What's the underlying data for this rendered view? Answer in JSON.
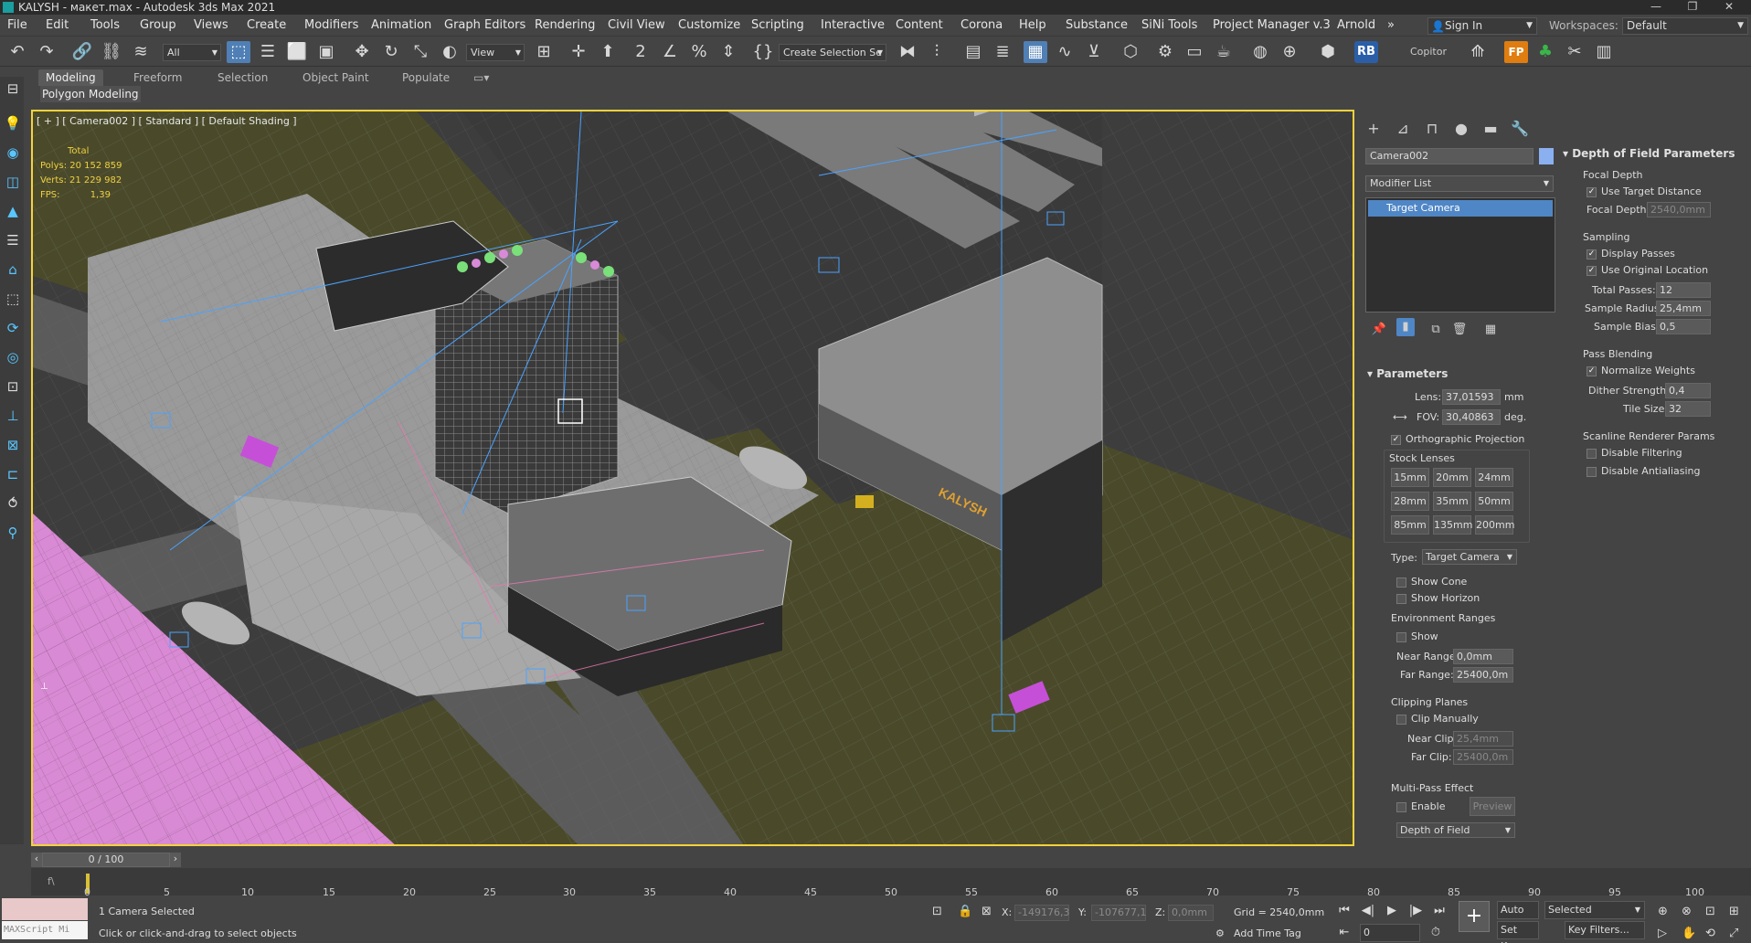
{
  "window": {
    "title": "KALYSH - макет.max - Autodesk 3ds Max 2021",
    "minimize": "—",
    "maximize": "❐",
    "close": "✕"
  },
  "menu": [
    "File",
    "Edit",
    "Tools",
    "Group",
    "Views",
    "Create",
    "Modifiers",
    "Animation",
    "Graph Editors",
    "Rendering",
    "Civil View",
    "Customize",
    "Scripting",
    "Interactive",
    "Content",
    "Corona",
    "Help",
    "Substance",
    "SiNi Tools",
    "Project Manager v.3",
    "Arnold"
  ],
  "menu_more": "»",
  "signin": "Sign In",
  "workspaces": {
    "label": "Workspaces:",
    "value": "Default"
  },
  "toolbar": {
    "filter": "All",
    "refcoord": "View",
    "selset": "Create Selection Se",
    "copitor": "Copitor",
    "rb": "RB",
    "fp": "FP",
    "two": "2",
    "pct": "%"
  },
  "ribbon": {
    "tabs": [
      "Modeling",
      "Freeform",
      "Selection",
      "Object Paint",
      "Populate"
    ],
    "sub": "Polygon Modeling"
  },
  "viewport": {
    "label": "[ + ] [ Camera002 ] [ Standard ] [ Default Shading ]",
    "stats": {
      "total_label": "Total",
      "polys_label": "Polys:",
      "polys": "20 152 859",
      "verts_label": "Verts:",
      "verts": "21 229 982",
      "fps_label": "FPS:",
      "fps": "1,39"
    },
    "sign": "KALYSH"
  },
  "cmd": {
    "object_name": "Camera002",
    "modifier_list": "Modifier List",
    "stack_item": "Target Camera",
    "params": {
      "header": "Parameters",
      "lens_label": "Lens:",
      "lens": "37,01593",
      "lens_unit": "mm",
      "fov_label": "FOV:",
      "fov": "30,40863",
      "fov_unit": "deg.",
      "ortho": "Orthographic Projection",
      "stock_label": "Stock Lenses",
      "stock": [
        "15mm",
        "20mm",
        "24mm",
        "28mm",
        "35mm",
        "50mm",
        "85mm",
        "135mm",
        "200mm"
      ],
      "type_label": "Type:",
      "type": "Target Camera",
      "show_cone": "Show Cone",
      "show_horizon": "Show Horizon",
      "env_label": "Environment Ranges",
      "env_show": "Show",
      "near_range_label": "Near Range:",
      "near_range": "0,0mm",
      "far_range_label": "Far Range:",
      "far_range": "25400,0m",
      "clip_label": "Clipping Planes",
      "clip_manually": "Clip Manually",
      "near_clip_label": "Near Clip:",
      "near_clip": "25,4mm",
      "far_clip_label": "Far Clip:",
      "far_clip": "25400,0m",
      "mpe_label": "Multi-Pass Effect",
      "enable": "Enable",
      "preview": "Preview",
      "effect": "Depth of Field"
    }
  },
  "dof": {
    "header": "Depth of Field Parameters",
    "focal_label": "Focal Depth",
    "use_target": "Use Target Distance",
    "focal_depth_label": "Focal Depth:",
    "focal_depth": "2540,0mm",
    "sampling_label": "Sampling",
    "display_passes": "Display Passes",
    "use_original": "Use Original Location",
    "total_passes_label": "Total Passes:",
    "total_passes": "12",
    "sample_radius_label": "Sample Radius:",
    "sample_radius": "25,4mm",
    "sample_bias_label": "Sample Bias:",
    "sample_bias": "0,5",
    "blending_label": "Pass Blending",
    "normalize": "Normalize Weights",
    "dither_label": "Dither Strength:",
    "dither": "0,4",
    "tile_label": "Tile Size:",
    "tile": "32",
    "scanline_label": "Scanline Renderer Params",
    "disable_filtering": "Disable Filtering",
    "disable_aa": "Disable Antialiasing"
  },
  "timeline": {
    "frame": "0 / 100",
    "ticks": [
      "0",
      "5",
      "10",
      "15",
      "20",
      "25",
      "30",
      "35",
      "40",
      "45",
      "50",
      "55",
      "60",
      "65",
      "70",
      "75",
      "80",
      "85",
      "90",
      "95",
      "100"
    ]
  },
  "status": {
    "selected": "1 Camera Selected",
    "prompt": "Click or click-and-drag to select objects",
    "maxscript": "MAXScript Mi",
    "x_label": "X:",
    "x": "-149176,3",
    "y_label": "Y:",
    "y": "-107677,1",
    "z_label": "Z:",
    "z": "0,0mm",
    "grid": "Grid = 2540,0mm",
    "add_time_tag": "Add Time Tag",
    "auto_key": "Auto Key",
    "set_key": "Set Key",
    "selected_dd": "Selected",
    "key_filters": "Key Filters...",
    "frame_field": "0"
  }
}
